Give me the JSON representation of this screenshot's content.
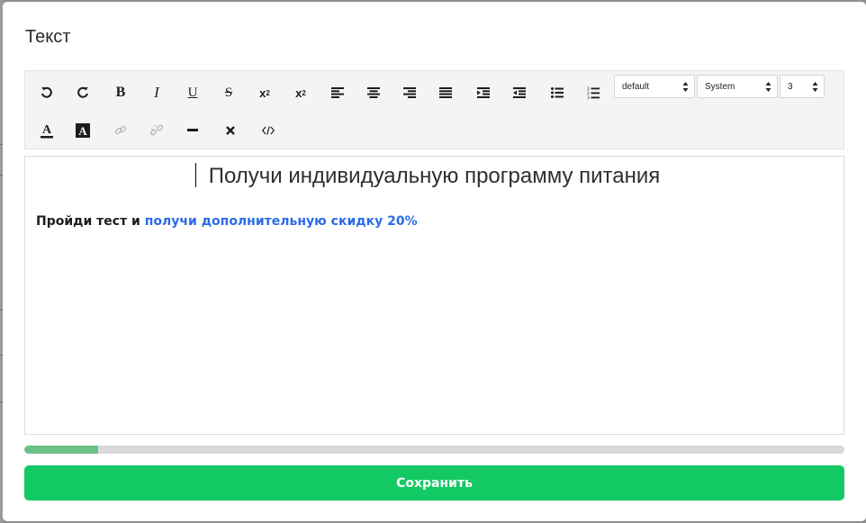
{
  "modal": {
    "title": "Текст"
  },
  "toolbar": {
    "row1": [
      {
        "name": "undo-icon",
        "glyph": "undo"
      },
      {
        "name": "redo-icon",
        "glyph": "redo"
      },
      {
        "name": "bold-icon",
        "glyph": "B"
      },
      {
        "name": "italic-icon",
        "glyph": "I"
      },
      {
        "name": "underline-icon",
        "glyph": "U"
      },
      {
        "name": "strikethrough-icon",
        "glyph": "S"
      },
      {
        "name": "subscript-icon",
        "glyph": "x2sub"
      },
      {
        "name": "superscript-icon",
        "glyph": "x2sup"
      },
      {
        "name": "align-left-icon",
        "glyph": "align-left"
      },
      {
        "name": "align-center-icon",
        "glyph": "align-center"
      },
      {
        "name": "align-right-icon",
        "glyph": "align-right"
      },
      {
        "name": "align-justify-icon",
        "glyph": "align-justify"
      },
      {
        "name": "indent-icon",
        "glyph": "indent"
      },
      {
        "name": "outdent-icon",
        "glyph": "outdent"
      },
      {
        "name": "bullet-list-icon",
        "glyph": "ul"
      },
      {
        "name": "numbered-list-icon",
        "glyph": "ol"
      }
    ],
    "row2": [
      {
        "name": "text-color-icon",
        "glyph": "A-color"
      },
      {
        "name": "background-color-icon",
        "glyph": "A-bg"
      },
      {
        "name": "link-icon",
        "glyph": "link",
        "disabled": true
      },
      {
        "name": "unlink-icon",
        "glyph": "unlink",
        "disabled": true
      },
      {
        "name": "horizontal-rule-icon",
        "glyph": "hr"
      },
      {
        "name": "clear-format-icon",
        "glyph": "x"
      },
      {
        "name": "code-view-icon",
        "glyph": "code"
      }
    ],
    "style_select": "default",
    "font_select": "System",
    "size_select": "3"
  },
  "editor": {
    "heading": "Получи индивидуальную программу питания",
    "paragraph_plain": "Пройди тест и ",
    "paragraph_link": "получи дополнительную скидку 20%",
    "link_color": "#2b6be8"
  },
  "progress": {
    "value_percent": 9,
    "fill_color": "#6cc08a"
  },
  "actions": {
    "save_label": "Сохранить",
    "save_color": "#13c963"
  }
}
